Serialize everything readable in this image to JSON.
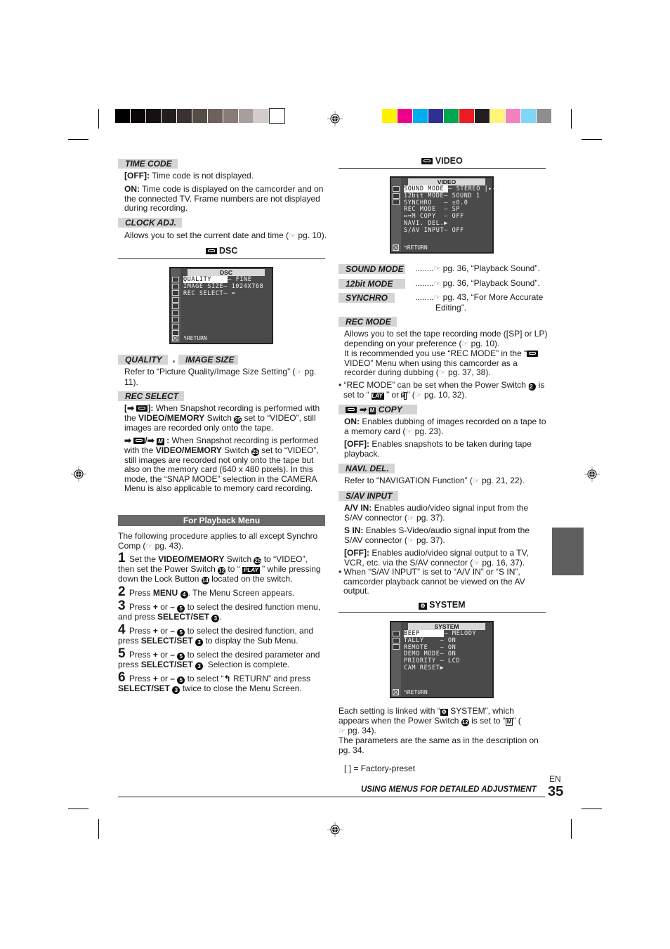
{
  "print_marks": {
    "gray_scale": [
      "#000000",
      "#0a0706",
      "#151110",
      "#241f1d",
      "#3a3331",
      "#554c48",
      "#6d625e",
      "#877c78",
      "#a89e9b",
      "#d3cccb",
      "#ffffff"
    ],
    "color_scale": [
      "#fff200",
      "#ec008c",
      "#00aeef",
      "#2e3192",
      "#00a651",
      "#ed1c24",
      "#231f20",
      "#fff578",
      "#f580c0",
      "#7fd6f6",
      "#8e8e8e"
    ]
  },
  "left": {
    "time_code": {
      "label": "TIME CODE",
      "off_key": "[OFF]:",
      "off_text": " Time code is not displayed.",
      "on_key": "ON:",
      "on_text": " Time code is displayed on the camcorder and on the connected TV. Frame numbers are not displayed during recording."
    },
    "clock_adj": {
      "label": "CLOCK ADJ.",
      "text": "Allows you to set the current date and time (",
      "ref": "pg. 10)."
    },
    "dsc": {
      "heading": "DSC",
      "screen": {
        "title": "DSC",
        "rows": [
          {
            "name": "QUALITY   ",
            "value": "– FINE",
            "highlighted": true
          },
          {
            "name": "IMAGE SIZE",
            "value": "– 1024X768",
            "highlighted": false
          },
          {
            "name": "REC SELECT",
            "value": "– ➡",
            "highlighted": false
          }
        ],
        "return_label": "RETURN"
      }
    },
    "quality_label": "QUALITY",
    "comma": ",",
    "image_size_label": "IMAGE SIZE",
    "quality_text": "Refer to “Picture Quality/Image Size Setting” (",
    "quality_ref": "pg. 11).",
    "rec_select": {
      "label": "REC SELECT",
      "opt1_key_prefix": "[➡ ",
      "opt1_key_suffix": "]:",
      "opt1_text_a": " When Snapshot recording is performed with the ",
      "opt1_bold": "VIDEO/MEMORY",
      "opt1_text_b": " Switch ",
      "opt1_circle": "25",
      "opt1_text_c": " set to “VIDEO”, still images are recorded only onto the tape.",
      "opt2_key": "➡ ",
      "opt2_sep": "/➡ ",
      "opt2_m": "M",
      "opt2_colon": " :",
      "opt2_text_a": " When Snapshot recording is performed with the ",
      "opt2_bold": "VIDEO/MEMORY",
      "opt2_text_b": " Switch ",
      "opt2_circle": "25",
      "opt2_text_c": " set to “VIDEO”, still images are recorded not only onto the tape but also on the memory card (640 x 480 pixels). In this mode, the “SNAP MODE” selection in the CAMERA Menu is also applicable to memory card recording."
    },
    "playback_menu": {
      "heading": "For Playback Menu",
      "intro": "The following procedure applies to all except Synchro Comp (",
      "intro_ref": "pg. 43).",
      "steps": [
        {
          "num": "1",
          "html_parts": [
            "Set the ",
            "VIDEO/MEMORY",
            " Switch ",
            "25",
            " to “VIDEO”, then set the Power Switch ",
            "12",
            " to “ ",
            "PLAY",
            " ” while pressing down the Lock Button ",
            "14",
            " located on the switch."
          ]
        },
        {
          "num": "2",
          "html_parts": [
            "Press ",
            "MENU",
            " ",
            "4",
            ". The Menu Screen appears."
          ]
        },
        {
          "num": "3",
          "html_parts": [
            "Press ",
            "+",
            " or ",
            "–",
            " ",
            "5",
            " to select the desired function menu, and press ",
            "SELECT/SET",
            " ",
            "3",
            "."
          ]
        },
        {
          "num": "4",
          "html_parts": [
            "Press ",
            "+",
            " or ",
            "–",
            " ",
            "5",
            " to select the desired function, and press ",
            "SELECT/SET",
            " ",
            "3",
            " to display the Sub Menu."
          ]
        },
        {
          "num": "5",
          "html_parts": [
            "Press ",
            "+",
            " or ",
            "–",
            " ",
            "5",
            " to select the desired parameter and press ",
            "SELECT/SET",
            " ",
            "3",
            ". Selection is complete."
          ]
        },
        {
          "num": "6",
          "html_parts": [
            "Press ",
            "+",
            " or ",
            "–",
            " ",
            "5",
            " to select “",
            "RETURN",
            "” and press ",
            "SELECT/SET",
            " ",
            "3",
            " twice to close the Menu Screen."
          ]
        }
      ]
    }
  },
  "right": {
    "video": {
      "heading": "VIDEO",
      "screen": {
        "title": "VIDEO",
        "rows": [
          {
            "name": "SOUND MODE",
            "value": "– STEREO |▸◂|",
            "highlighted": true
          },
          {
            "name": "12bit MODE",
            "value": "– SOUND 1",
            "highlighted": false
          },
          {
            "name": "SYNCHRO   ",
            "value": "– ±0.0",
            "highlighted": false
          },
          {
            "name": "REC MODE  ",
            "value": "– SP",
            "highlighted": false
          },
          {
            "name": "▭➡M COPY  ",
            "value": "– OFF",
            "highlighted": false
          },
          {
            "name": "NAVI. DEL.",
            "value": "▶",
            "highlighted": false
          },
          {
            "name": "S/AV INPUT",
            "value": "– OFF",
            "highlighted": false
          }
        ],
        "return_label": "RETURN"
      },
      "refs": [
        {
          "label": "SOUND MODE",
          "dots": "........",
          "text": "pg. 36, “Playback Sound”."
        },
        {
          "label": "12bit MODE",
          "dots": "........",
          "text": "pg. 36, “Playback Sound”."
        },
        {
          "label": "SYNCHRO",
          "dots": "........",
          "text": "pg. 43, “For More Accurate Editing”."
        }
      ],
      "rec_mode": {
        "label": "REC MODE",
        "text_a": "Allows you to set the tape recording mode ([SP] or LP) depending on your preference (",
        "ref_a": "pg. 10).",
        "text_b": "It is recommended you use “REC MODE” in the “",
        "text_b2": " VIDEO” Menu when using this camcorder as a recorder during dubbing (",
        "ref_b": "pg. 37, 38).",
        "bullet_a": "• “REC MODE” can be set when the Power Switch ",
        "bullet_circle": "12",
        "bullet_b": " is set to “ ",
        "bullet_play": "PLAY",
        "bullet_c": " ” or “",
        "bullet_m": "M",
        "bullet_d": "” (",
        "bullet_ref": "pg. 10, 32)."
      },
      "copy": {
        "label": "COPY",
        "m": "M",
        "on_key": "ON:",
        "on_text": " Enables dubbing of images recorded on a tape to a memory card (",
        "on_ref": "pg. 23).",
        "off_key": "[OFF]:",
        "off_text": " Enables snapshots to be taken during tape playback."
      },
      "navi_del": {
        "label": "NAVI. DEL.",
        "text": "Refer to “NAVIGATION Function” (",
        "ref": "pg. 21, 22)."
      },
      "sav_input": {
        "label": "S/AV INPUT",
        "av_key": "A/V IN:",
        "av_text": " Enables audio/video signal input from the S/AV connector (",
        "av_ref": "pg. 37).",
        "s_key": "S IN:",
        "s_text": " Enables S-Video/audio signal input from the S/AV connector (",
        "s_ref": "pg. 37).",
        "off_key": "[OFF]:",
        "off_text": " Enables audio/video signal output to a TV, VCR, etc. via the S/AV connector (",
        "off_ref": "pg. 16, 37).",
        "bullet": "• When “S/AV INPUT” is set to “A/V IN” or “S IN”, camcorder playback cannot be viewed on the AV output."
      }
    },
    "system": {
      "heading": "SYSTEM",
      "screen": {
        "title": "SYSTEM",
        "rows": [
          {
            "name": "BEEP     ",
            "value": "– MELODY",
            "highlighted": true
          },
          {
            "name": "TALLY    ",
            "value": "– ON",
            "highlighted": false
          },
          {
            "name": "REMOTE   ",
            "value": "– ON",
            "highlighted": false
          },
          {
            "name": "DEMO MODE",
            "value": "– ON",
            "highlighted": false
          },
          {
            "name": "PRIORITY ",
            "value": "– LCD",
            "highlighted": false
          },
          {
            "name": "CAM RESET",
            "value": "▶",
            "highlighted": false
          }
        ],
        "return_label": "RETURN"
      },
      "text_a": "Each setting is linked with “",
      "text_a2": " SYSTEM”, which appears when the Power Switch ",
      "circle": "12",
      "text_b": " is set to “",
      "m": "M",
      "text_c": "” (",
      "ref": "pg. 34).",
      "text_d": "The parameters are the same as in the description on pg. 34."
    },
    "factory_preset": "[  ] = Factory-preset"
  },
  "footer": {
    "lang": "EN",
    "section": "USING MENUS FOR DETAILED ADJUSTMENT",
    "page": "35"
  }
}
